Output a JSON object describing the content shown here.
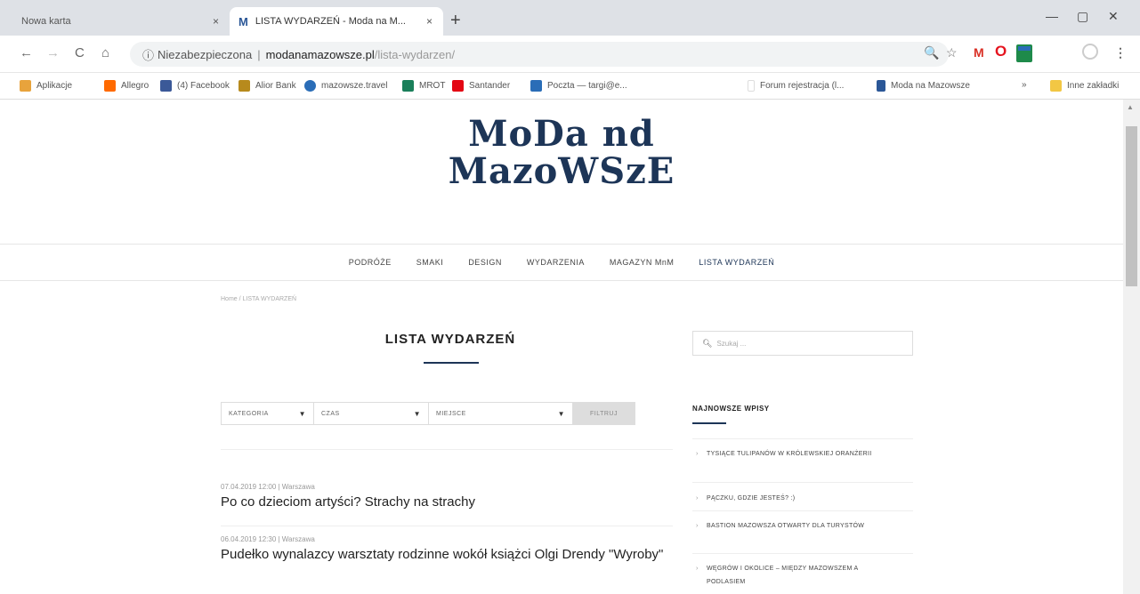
{
  "browser": {
    "tabs": [
      {
        "label": "Nowa karta",
        "close": "×"
      },
      {
        "favicon": "M",
        "label": "LISTA WYDARZEŃ - Moda na M...",
        "close": "×"
      }
    ],
    "new_tab": "+",
    "window_controls": {
      "minimize": "—",
      "maximize": "▢",
      "close": "✕"
    },
    "nav": {
      "back": "←",
      "forward": "→",
      "reload": "C",
      "home": "⌂"
    },
    "address": {
      "info": "ⓘ",
      "insecure_label": "Niezabezpieczona",
      "separator": "|",
      "host": "modanamazowsze.pl",
      "path": "/lista-wydarzen/"
    },
    "toolbar_icons": {
      "zoom": "🔍",
      "star": "☆",
      "gmail": "M",
      "opera": "O",
      "menu": "⋮"
    },
    "bookmarks": [
      {
        "label": "Aplikacje",
        "color": "#e8a33c"
      },
      {
        "label": "Allegro",
        "color": "#ff6a00"
      },
      {
        "label": "(4) Facebook",
        "color": "#3b5998"
      },
      {
        "label": "Alior Bank",
        "color": "#b78a1d"
      },
      {
        "label": "mazowsze.travel",
        "color": "#2a6db7"
      },
      {
        "label": "MROT",
        "color": "#1a7f5a"
      },
      {
        "label": "Santander",
        "color": "#e30613"
      },
      {
        "label": "Poczta — targi@e...",
        "color": "#2a6db7"
      },
      {
        "label": "Forum rejestracja (l...",
        "color": "#dddddd"
      },
      {
        "label": "Moda na Mazowsze",
        "color": "#2b5797"
      },
      {
        "label": "»",
        "color": "#ffffff"
      },
      {
        "label": "Inne zakładki",
        "color": "#f2c744"
      }
    ]
  },
  "site": {
    "logo_line1": "MoDa nd",
    "logo_line2": "MazoWSzE",
    "nav": [
      "PODRÓŻE",
      "SMAKI",
      "DESIGN",
      "WYDARZENIA",
      "MAGAZYN MnM",
      "LISTA WYDARZEŃ"
    ],
    "breadcrumb": "Home  /  LISTA WYDARZEŃ",
    "title": "LISTA WYDARZEŃ",
    "search_placeholder": "Szukaj ...",
    "filters": {
      "kategoria": "KATEGORIA",
      "czas": "CZAS",
      "miejsce": "MIEJSCE",
      "arrow": "▼",
      "button": "FILTRUJ"
    },
    "events": [
      {
        "meta": "07.04.2019 12:00  |  Warszawa",
        "title": "Po co dzieciom artyści? Strachy na strachy"
      },
      {
        "meta": "06.04.2019 12:30  |  Warszawa",
        "title": "Pudełko wynalazcy warsztaty rodzinne wokół książci Olgi Drendy \"Wyroby\""
      }
    ],
    "sidebar": {
      "heading": "NAJNOWSZE WPISY",
      "items": [
        "TYSIĄCE TULIPANÓW W KRÓLEWSKIEJ ORANŻERII",
        "PĄCZKU, GDZIE JESTEŚ? :)",
        "BASTION MAZOWSZA OTWARTY DLA TURYSTÓW",
        "WĘGRÓW I OKOLICE – MIĘDZY MAZOWSZEM A PODLASIEM"
      ]
    }
  },
  "colors": {
    "brand": "#1d3557"
  }
}
